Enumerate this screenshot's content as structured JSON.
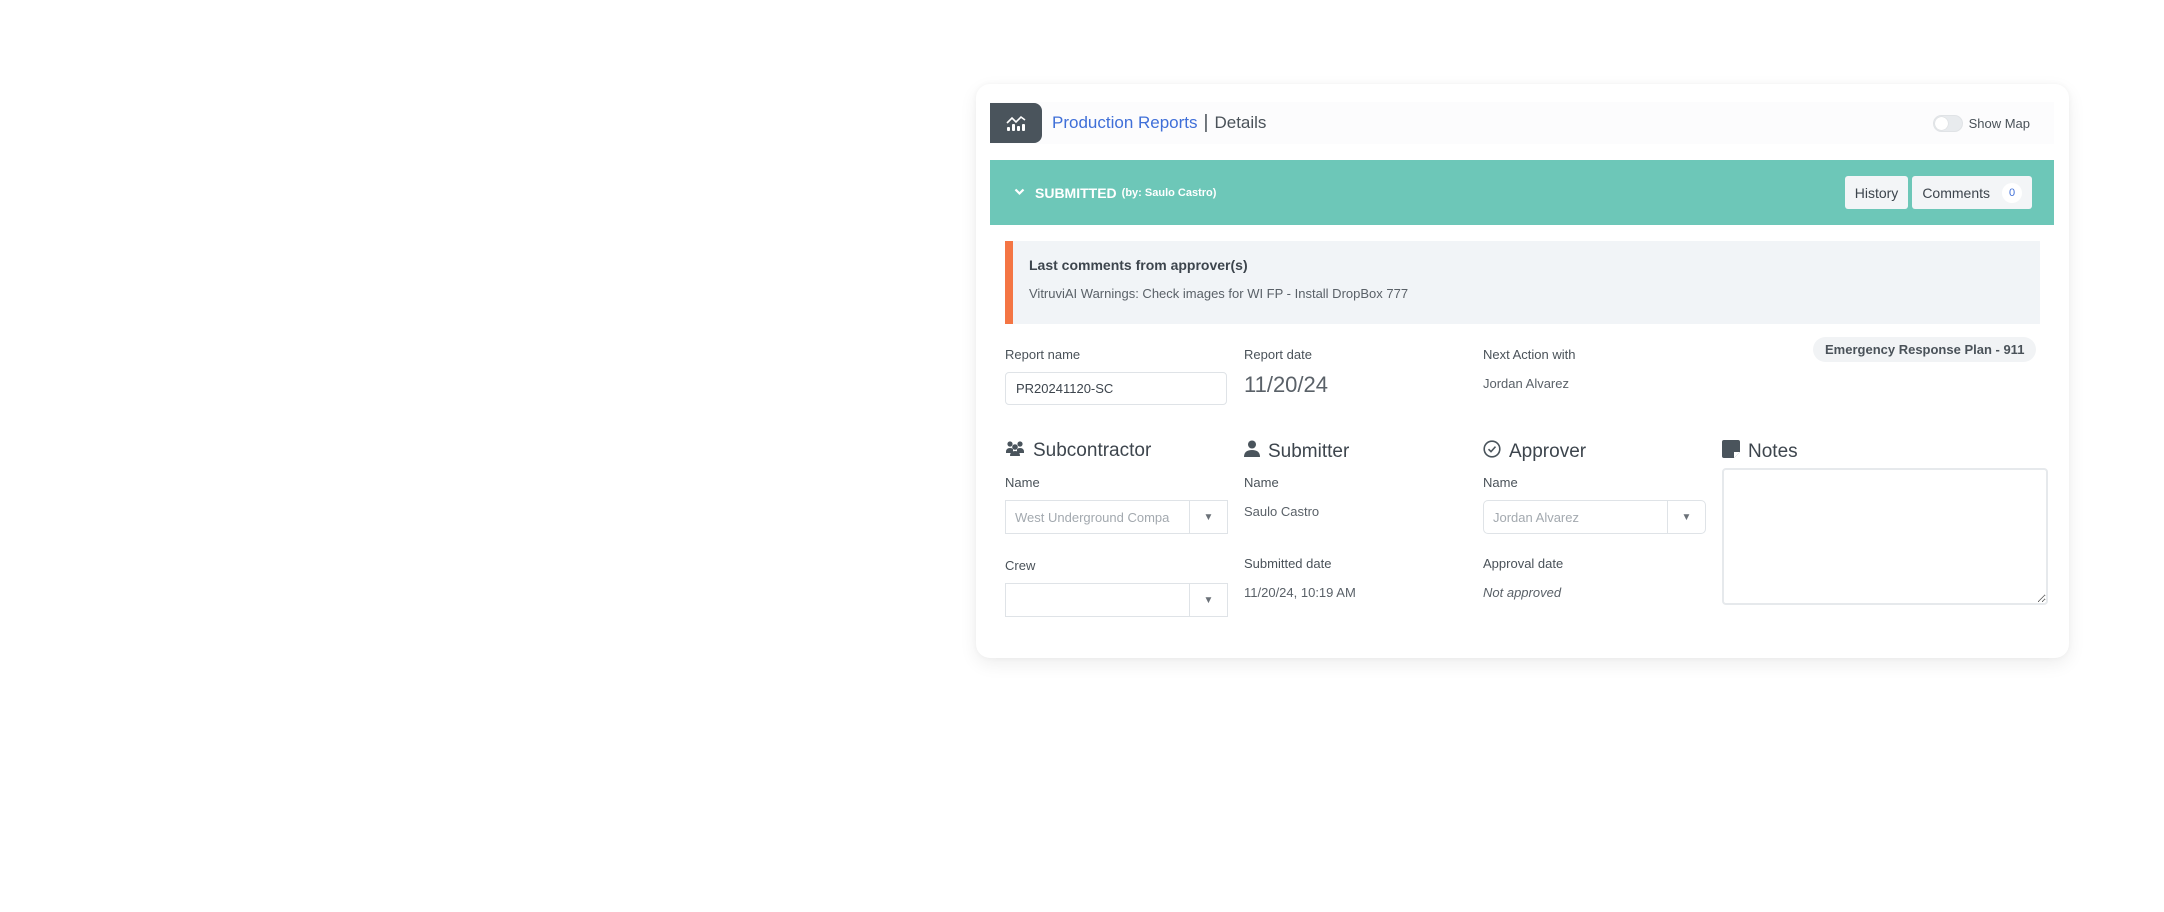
{
  "header": {
    "app_icon": "chart-line-bar-icon",
    "title_link": "Production Reports",
    "separator": "|",
    "title_sub": "Details",
    "show_map_label": "Show Map",
    "show_map_on": false
  },
  "status": {
    "chevron_icon": "chevron-down-icon",
    "state": "SUBMITTED",
    "by": "(by: Saulo Castro)",
    "history_label": "History",
    "comments_label": "Comments",
    "comments_count": "0",
    "bar_color": "#6dc7b8"
  },
  "approver_comments": {
    "title": "Last comments from approver(s)",
    "body": "VitruviAI Warnings: Check images for WI FP - Install DropBox 777",
    "accent_color": "#f47544"
  },
  "report": {
    "name_label": "Report name",
    "name_value": "PR20241120-SC",
    "date_label": "Report date",
    "date_value": "11/20/24",
    "next_action_label": "Next Action with",
    "next_action_value": "Jordan Alvarez",
    "tag": "Emergency Response Plan - 911"
  },
  "subcontractor": {
    "icon": "users-icon",
    "title": "Subcontractor",
    "name_label": "Name",
    "name_value": "West Underground Compa",
    "crew_label": "Crew",
    "crew_value": ""
  },
  "submitter": {
    "icon": "user-icon",
    "title": "Submitter",
    "name_label": "Name",
    "name_value": "Saulo Castro",
    "submitted_date_label": "Submitted date",
    "submitted_date_value": "11/20/24, 10:19 AM"
  },
  "approver": {
    "icon": "check-circle-icon",
    "title": "Approver",
    "name_label": "Name",
    "name_value": "Jordan Alvarez",
    "approval_date_label": "Approval date",
    "approval_date_value": "Not approved"
  },
  "notes": {
    "icon": "sticky-note-icon",
    "title": "Notes",
    "value": ""
  }
}
